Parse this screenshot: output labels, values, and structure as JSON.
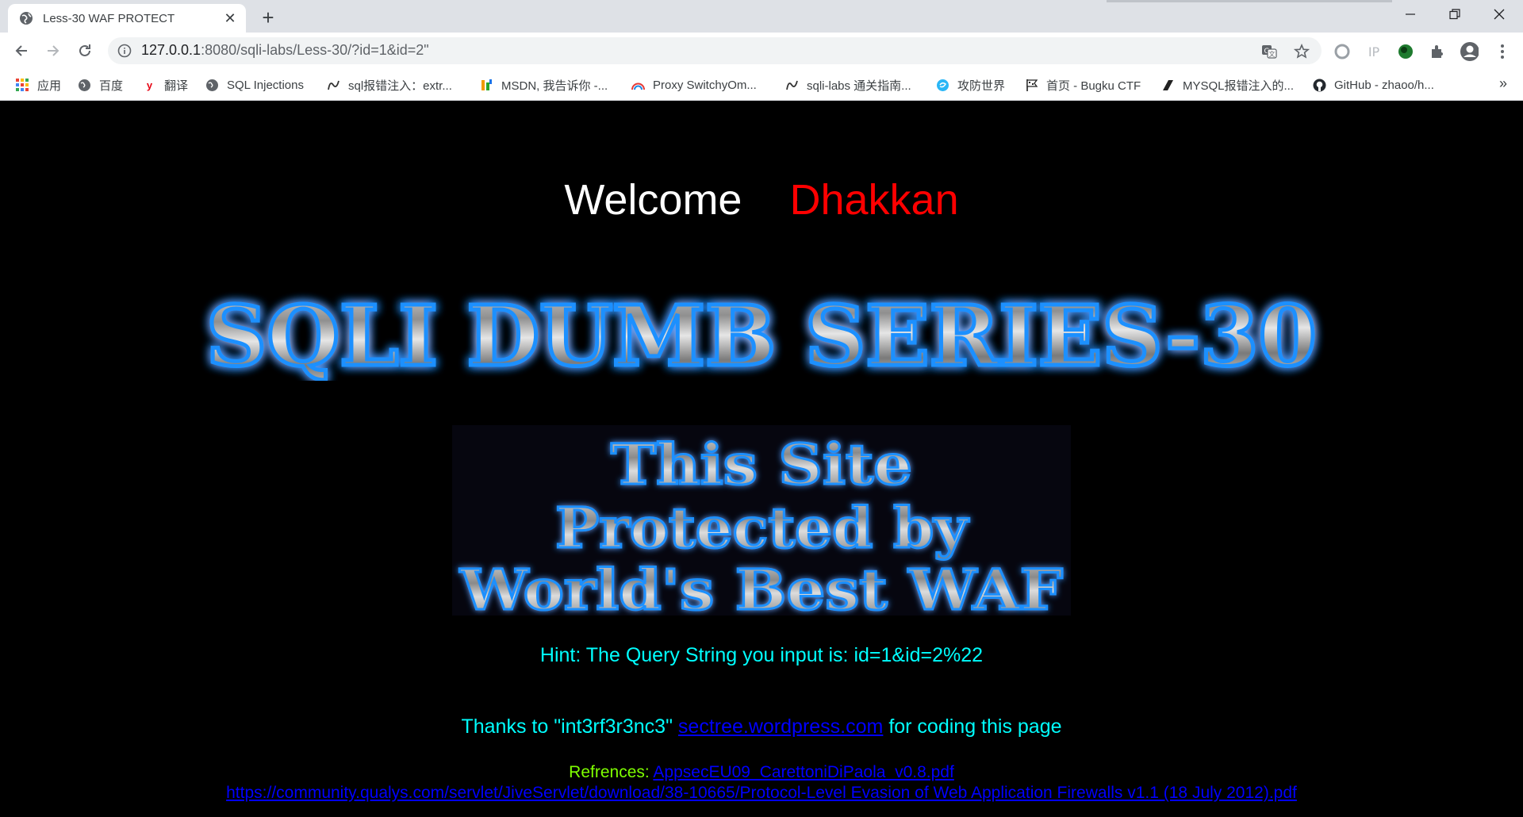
{
  "browser": {
    "tab": {
      "title": "Less-30 WAF PROTECT"
    },
    "url": {
      "host": "127.0.0.1",
      "rest": ":8080/sqli-labs/Less-30/?id=1&id=2\""
    },
    "bookmarks": [
      {
        "label": "应用",
        "icon": "apps-grid-icon"
      },
      {
        "label": "百度",
        "icon": "globe-icon"
      },
      {
        "label": "翻译",
        "icon": "youdao-icon"
      },
      {
        "label": "SQL Injections",
        "icon": "globe-icon"
      },
      {
        "label": "sql报错注入：extr...",
        "icon": "squiggle-icon"
      },
      {
        "label": "MSDN, 我告诉你 -...",
        "icon": "msdn-icon"
      },
      {
        "label": "Proxy SwitchyOm...",
        "icon": "rainbow-icon"
      },
      {
        "label": "sqli-labs 通关指南...",
        "icon": "squiggle-icon"
      },
      {
        "label": "攻防世界",
        "icon": "swirl-icon"
      },
      {
        "label": "首页 - Bugku CTF",
        "icon": "flag-icon"
      },
      {
        "label": "MYSQL报错注入的...",
        "icon": "slash-icon"
      },
      {
        "label": "GitHub - zhaoo/h...",
        "icon": "github-icon"
      }
    ]
  },
  "page": {
    "welcome": "Welcome",
    "user": "Dhakkan",
    "banner": "SQLI DUMB SERIES-30",
    "waf_lines": [
      "This Site",
      "Protected by",
      "World's Best WAF"
    ],
    "hint": "Hint: The Query String you input is: id=1&id=2%22",
    "thanks_prefix": "Thanks to \"int3rf3r3nc3\"",
    "thanks_link": "sectree.wordpress.com",
    "thanks_suffix": "for coding this page",
    "refs_label": "Refrences:",
    "ref1": "AppsecEU09_CarettoniDiPaola_v0.8.pdf",
    "ref2": "https://community.qualys.com/servlet/JiveServlet/download/38-10665/Protocol-Level Evasion of Web Application Firewalls v1.1 (18 July 2012).pdf"
  },
  "colors": {
    "welcome": "#ffffff",
    "user": "#ff0000",
    "hint": "#00ffff",
    "link": "#0000ff",
    "refs_label": "#7fff00",
    "banner_glow": "#1e90ff"
  }
}
